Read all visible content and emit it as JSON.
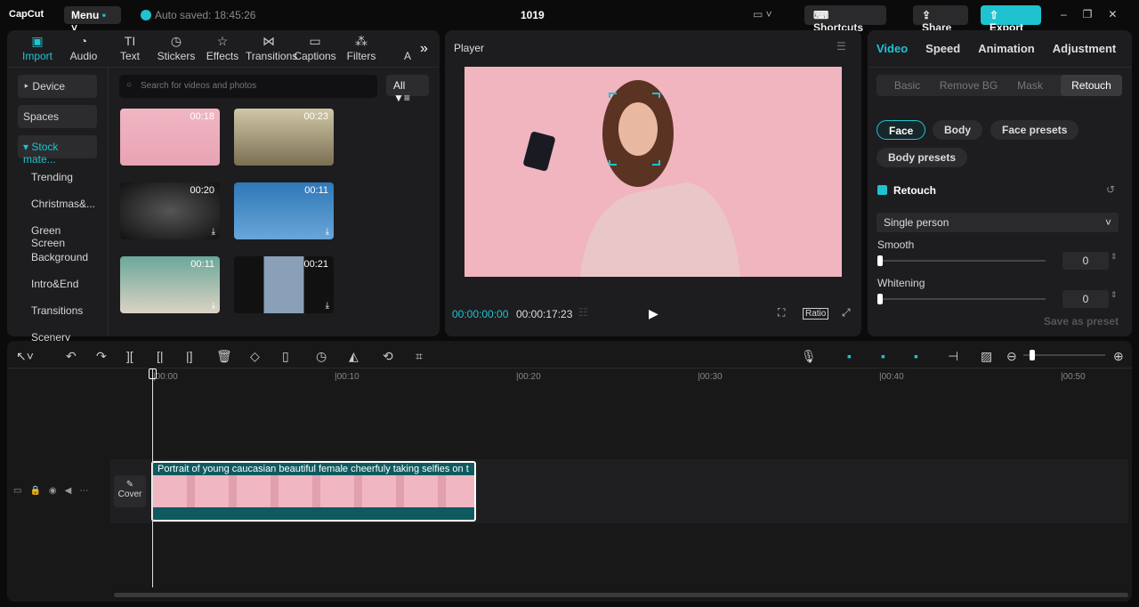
{
  "app": {
    "logo": "CapCut",
    "menu": "Menu",
    "autosave": "Auto saved: 18:45:26",
    "title": "1019",
    "shortcuts": "Shortcuts",
    "share": "Share",
    "export": "Export"
  },
  "media_tabs": [
    {
      "label": "Import",
      "icon": "▣"
    },
    {
      "label": "Audio",
      "icon": "◔"
    },
    {
      "label": "Text",
      "icon": "TI"
    },
    {
      "label": "Stickers",
      "icon": "◷"
    },
    {
      "label": "Effects",
      "icon": "☆"
    },
    {
      "label": "Transitions",
      "icon": "⋈"
    },
    {
      "label": "Captions",
      "icon": "▭"
    },
    {
      "label": "Filters",
      "icon": "⁂"
    },
    {
      "label": "A",
      "icon": ""
    }
  ],
  "sidebar": {
    "device": "Device",
    "spaces": "Spaces",
    "stock": "Stock mate...",
    "items": [
      "Trending",
      "Christmas&...",
      "Green Screen",
      "Background",
      "Intro&End",
      "Transitions",
      "Scenery"
    ]
  },
  "search": {
    "placeholder": "Search for videos and photos",
    "filter": "All"
  },
  "thumbs": [
    {
      "dur": "00:18"
    },
    {
      "dur": "00:23"
    },
    {
      "dur": "00:20"
    },
    {
      "dur": "00:11"
    },
    {
      "dur": "00:11"
    },
    {
      "dur": "00:21"
    }
  ],
  "player": {
    "title": "Player",
    "current": "00:00:00:00",
    "total": "00:00:17:23",
    "ratio": "Ratio"
  },
  "right": {
    "tabs": [
      "Video",
      "Speed",
      "Animation",
      "Adjustment"
    ],
    "sub_tabs": [
      "Basic",
      "Remove BG",
      "Mask",
      "Retouch"
    ],
    "pills": [
      "Face",
      "Body",
      "Face presets",
      "Body presets"
    ],
    "retouch": "Retouch",
    "mode": "Single person",
    "smooth": {
      "label": "Smooth",
      "value": "0"
    },
    "whitening": {
      "label": "Whitening",
      "value": "0"
    },
    "save_preset": "Save as preset"
  },
  "timeline": {
    "ticks": [
      "00:00",
      "00:10",
      "00:20",
      "00:30",
      "00:40",
      "00:50"
    ],
    "clip_title": "Portrait of young caucasian beautiful female cheerfuly taking selfies on t",
    "cover": "Cover",
    "zoom_level": 0.02
  },
  "colors": {
    "accent": "#1fc3d0",
    "clip": "#0f5a5e"
  }
}
